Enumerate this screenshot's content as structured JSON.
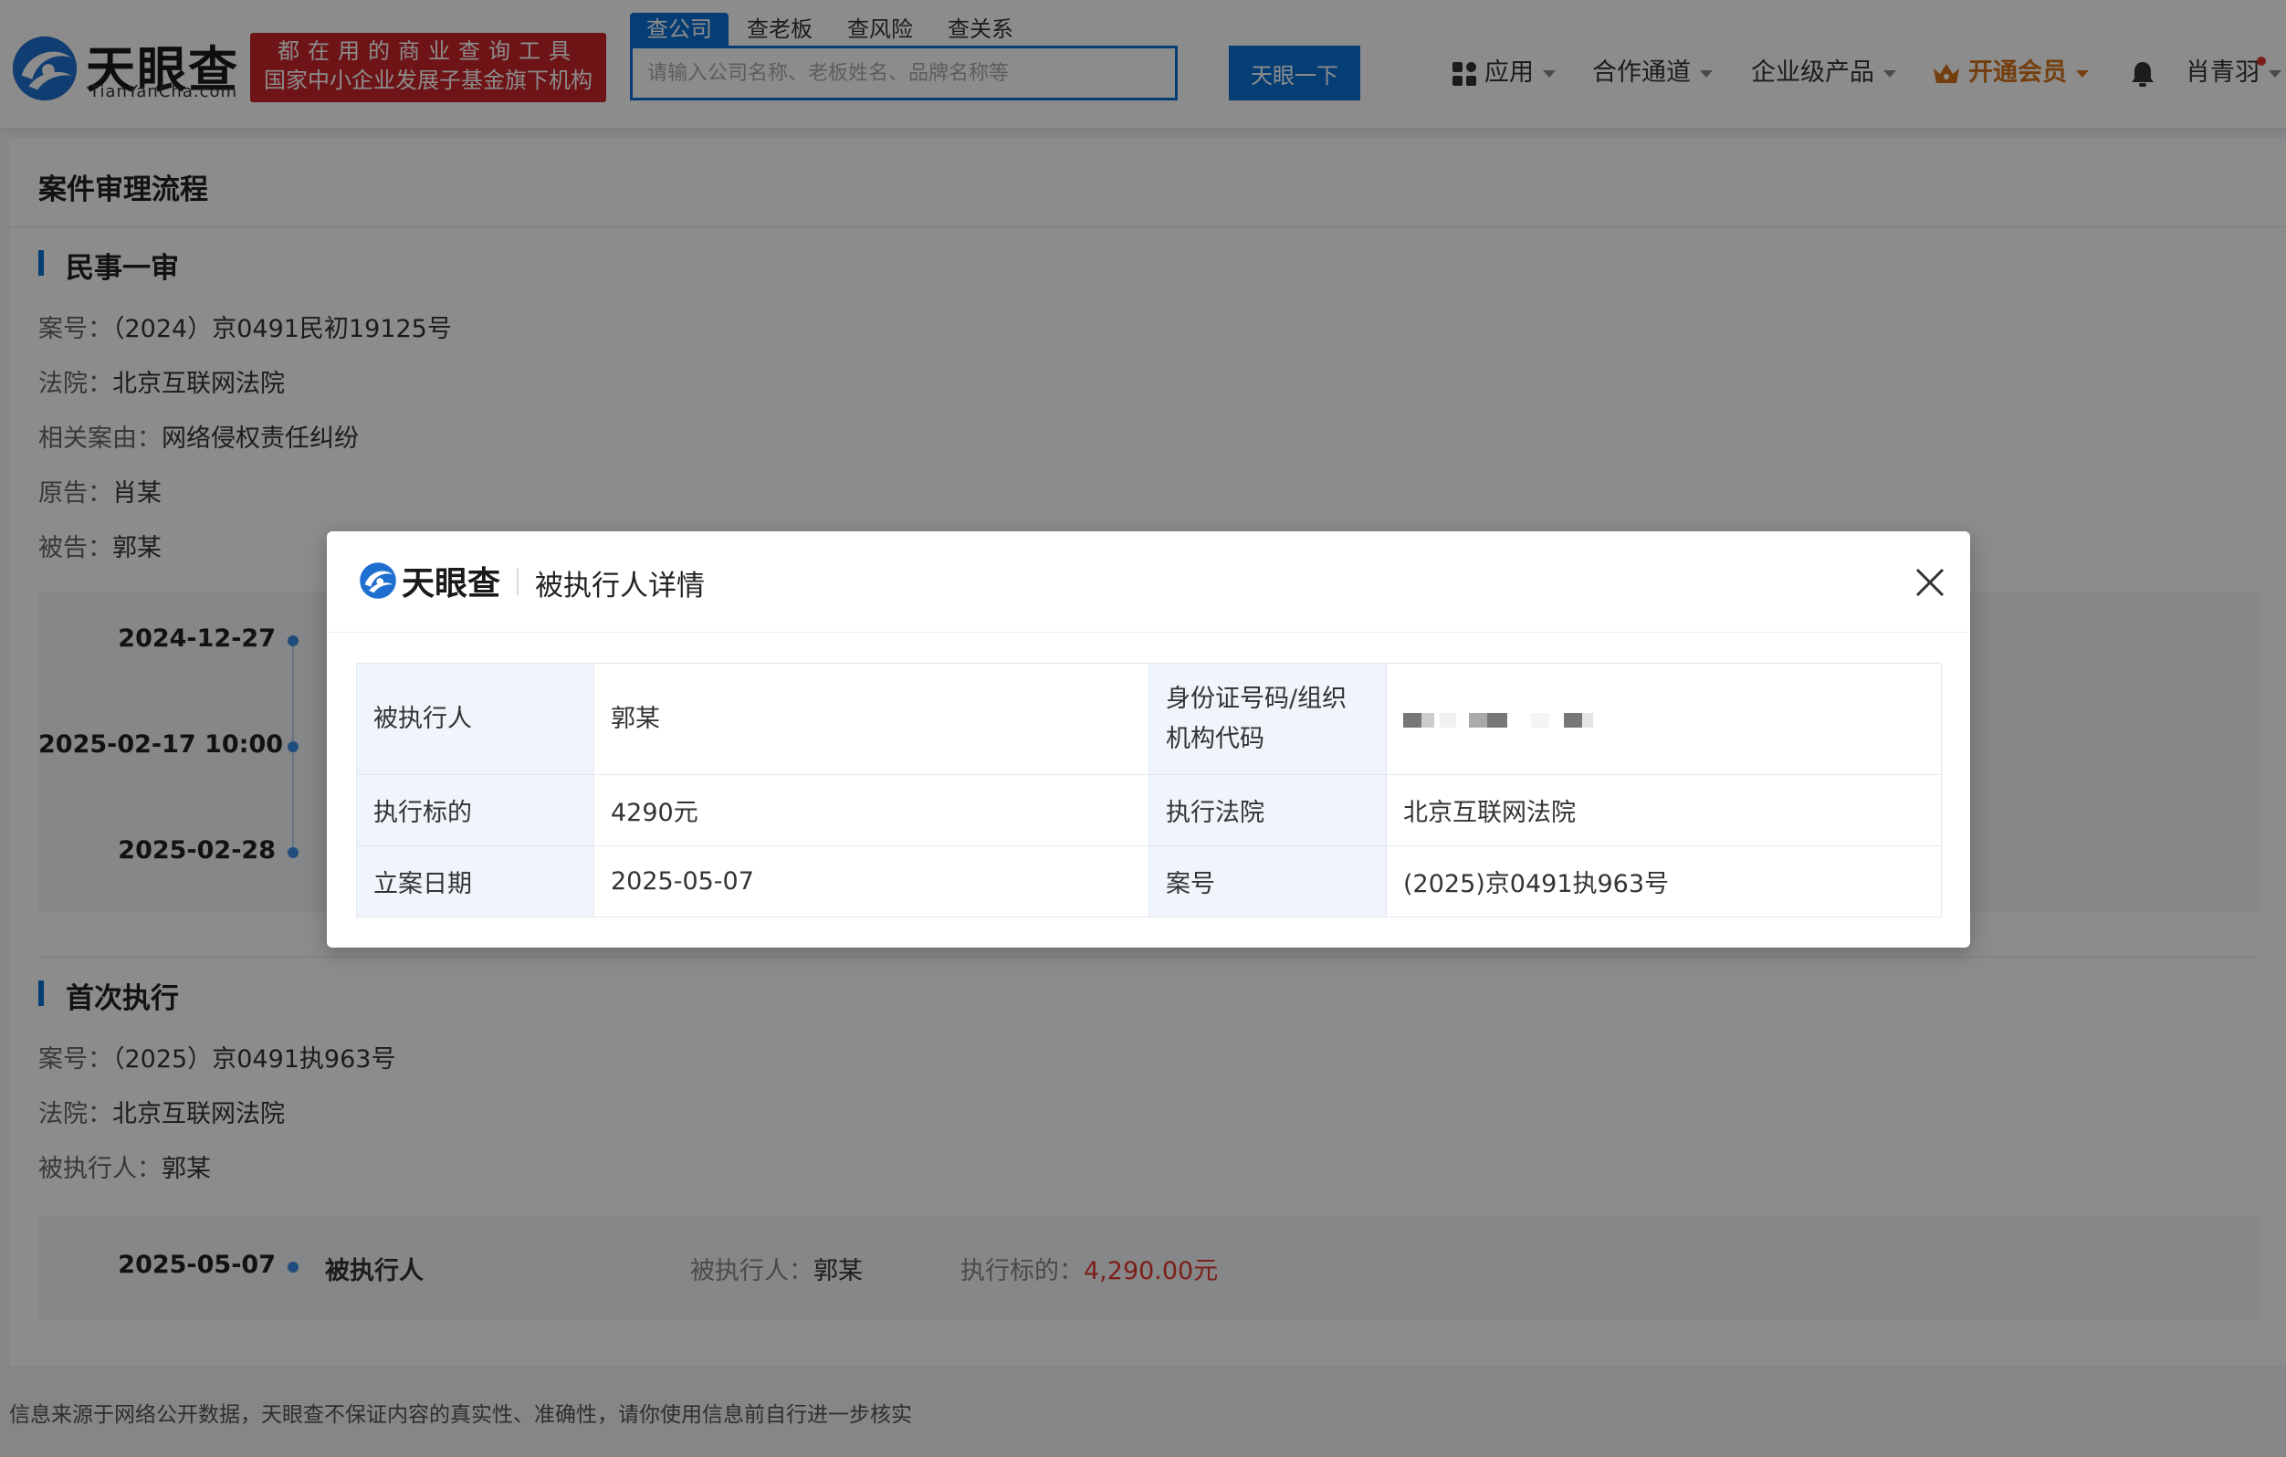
{
  "header": {
    "logo_text": "天眼查",
    "logo_domain": "TianYanCha.com",
    "slogan_line1": "都在用的商业查询工具",
    "slogan_line2": "国家中小企业发展子基金旗下机构",
    "search_tabs": [
      "查公司",
      "查老板",
      "查风险",
      "查关系"
    ],
    "search_placeholder": "请输入公司名称、老板姓名、品牌名称等",
    "search_button": "天眼一下",
    "nav": {
      "apps": "应用",
      "partners": "合作通道",
      "enterprise": "企业级产品",
      "vip": "开通会员",
      "user": "肖青羽"
    }
  },
  "page": {
    "title": "案件审理流程",
    "first_instance": {
      "title": "民事一审",
      "case_no_label": "案号：",
      "case_no": "（2024）京0491民初19125号",
      "court_label": "法院：",
      "court": "北京互联网法院",
      "cause_label": "相关案由：",
      "cause": "网络侵权责任纠纷",
      "plaintiff_label": "原告：",
      "plaintiff": "肖某",
      "defendant_label": "被告：",
      "defendant": "郭某",
      "timeline": [
        "2024-12-27",
        "2025-02-17 10:00",
        "2025-02-28"
      ]
    },
    "execution": {
      "title": "首次执行",
      "case_no_label": "案号：",
      "case_no": "（2025）京0491执963号",
      "court_label": "法院：",
      "court": "北京互联网法院",
      "person_label": "被执行人：",
      "person": "郭某",
      "event": {
        "date": "2025-05-07",
        "type": "被执行人",
        "person_label": "被执行人：",
        "person": "郭某",
        "amount_label": "执行标的：",
        "amount": "4,290.00元"
      }
    },
    "footer_note": "信息来源于网络公开数据，天眼查不保证内容的真实性、准确性，请你使用信息前自行进一步核实"
  },
  "modal": {
    "logo_text": "天眼查",
    "title": "被执行人详情",
    "rows": [
      {
        "k1": "被执行人",
        "v1": "郭某",
        "k2": "身份证号码/组织机构代码",
        "v2": ""
      },
      {
        "k1": "执行标的",
        "v1": "4290元",
        "k2": "执行法院",
        "v2": "北京互联网法院"
      },
      {
        "k1": "立案日期",
        "v1": "2025-05-07",
        "k2": "案号",
        "v2": "(2025)京0491执963号"
      }
    ]
  },
  "colors": {
    "brand_blue": "#0a70d6",
    "slogan_red": "#c8262b",
    "vip_orange": "#d4731c",
    "money_red": "#e03a2f"
  },
  "icons": [
    "tianyancha-logo-icon",
    "apps-grid-icon",
    "crown-icon",
    "bell-icon",
    "close-icon",
    "chevron-down-icon"
  ]
}
